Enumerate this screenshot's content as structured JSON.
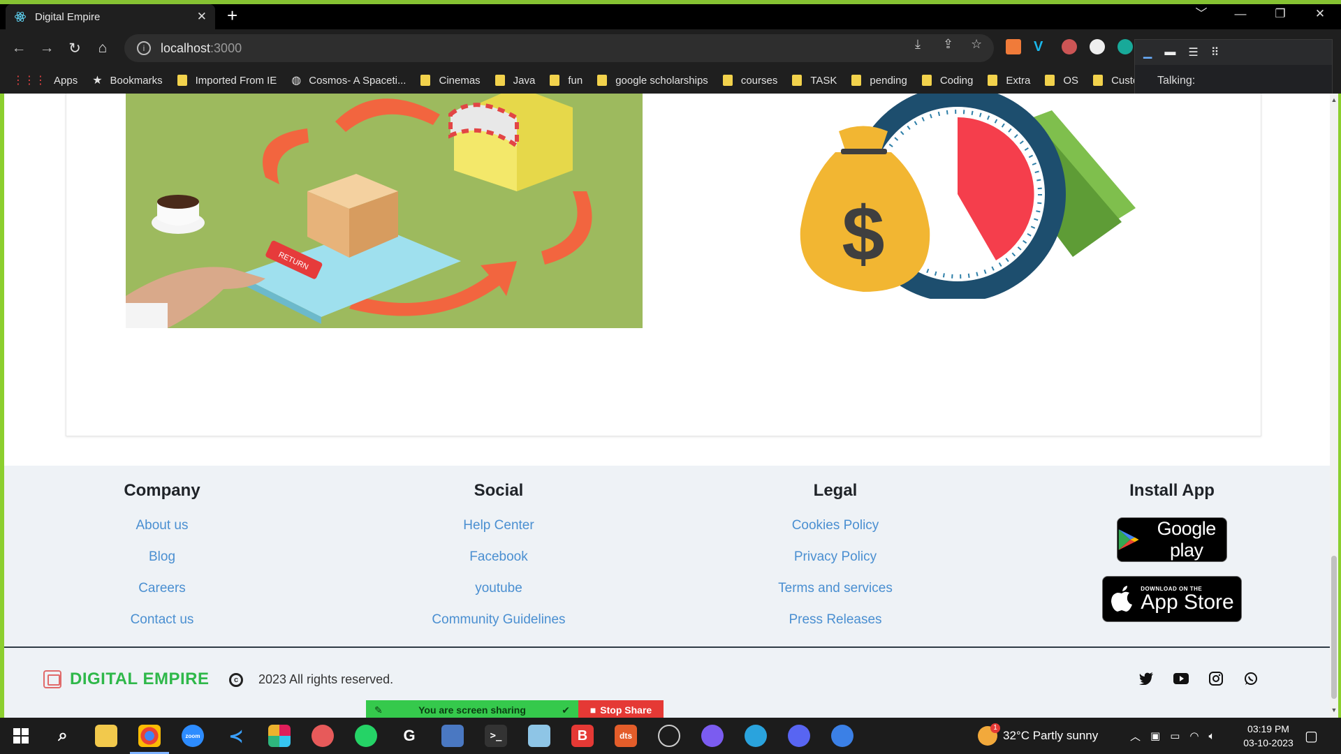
{
  "browser": {
    "tab_title": "Digital Empire",
    "tab_close": "✕",
    "new_tab": "+",
    "address_host": "localhost",
    "address_port": ":3000",
    "window_controls": [
      "﹀",
      "—",
      "❐",
      "✕"
    ],
    "bookmarks": [
      {
        "label": "Apps",
        "icon": "apps-grid-icon"
      },
      {
        "label": "Bookmarks",
        "icon": "star-icon"
      },
      {
        "label": "Imported From IE",
        "icon": "folder-icon"
      },
      {
        "label": "Cosmos- A Spaceti...",
        "icon": "globe-icon"
      },
      {
        "label": "Cinemas",
        "icon": "folder-icon"
      },
      {
        "label": "Java",
        "icon": "folder-icon"
      },
      {
        "label": "fun",
        "icon": "folder-icon"
      },
      {
        "label": "google scholarships",
        "icon": "folder-icon"
      },
      {
        "label": "courses",
        "icon": "folder-icon"
      },
      {
        "label": "TASK",
        "icon": "folder-icon"
      },
      {
        "label": "pending",
        "icon": "folder-icon"
      },
      {
        "label": "Coding",
        "icon": "folder-icon"
      },
      {
        "label": "Extra",
        "icon": "folder-icon"
      },
      {
        "label": "OS",
        "icon": "folder-icon"
      },
      {
        "label": "Custo",
        "icon": "folder-icon"
      }
    ],
    "talking_label": "Talking:"
  },
  "footer": {
    "company": {
      "heading": "Company",
      "links": [
        "About us",
        "Blog",
        "Careers",
        "Contact us"
      ]
    },
    "social": {
      "heading": "Social",
      "links": [
        "Help Center",
        "Facebook",
        "youtube",
        "Community Guidelines"
      ]
    },
    "legal": {
      "heading": "Legal",
      "links": [
        "Cookies Policy",
        "Privacy Policy",
        "Terms and services",
        "Press Releases"
      ]
    },
    "install": {
      "heading": "Install App",
      "google_play": "Google play",
      "app_store_small": "DOWNLOAD ON THE",
      "app_store_big": "App Store"
    },
    "brand": "DIGITAL EMPIRE",
    "copyright": "2023 All rights reserved.",
    "social_icons": [
      "twitter-icon",
      "youtube-icon",
      "instagram-icon",
      "whatsapp-icon"
    ]
  },
  "illustrations": {
    "return_label": "RETURN",
    "money_symbol": "$"
  },
  "screen_share": {
    "status": "You are screen sharing",
    "stop": "Stop Share"
  },
  "taskbar": {
    "weather": "32°C  Partly sunny",
    "weather_badge": "1",
    "time": "03:19 PM",
    "date": "03-10-2023",
    "app_labels": {
      "zoom": "zoom",
      "brave": "B",
      "dts": "dts"
    }
  }
}
